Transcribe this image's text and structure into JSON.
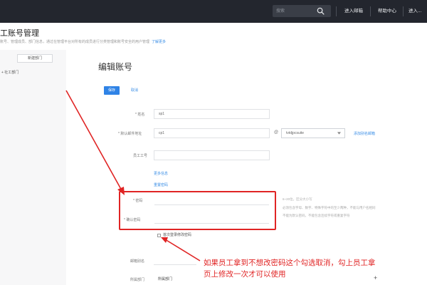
{
  "topbar": {
    "search_placeholder": "搜索",
    "nav": [
      "进入邮箱",
      "帮助中心",
      "进入..."
    ]
  },
  "page": {
    "title": "工账号管理",
    "desc": "账号、管理成员、部门信息，通过在管理平台对所有的成员进行分类管理和账号安全的用户管理",
    "learn_more": "了解更多"
  },
  "sidebar": {
    "new_dept": "新建部门",
    "tree_item": "+ 社工部门"
  },
  "form": {
    "title": "编辑账号",
    "save": "保存",
    "cancel": "取消",
    "name_label": "* 姓名",
    "name_value": "sp1",
    "account_label": "* 默认邮件地址",
    "account_value": "cp1",
    "at": "@",
    "domain_value": "tvtdjpcsuite",
    "bind_link": "添加别名邮箱",
    "employee_id_label": "员工工号",
    "more_link": "更多信息",
    "reset_link": "重置密码",
    "password_label": "* 密码",
    "confirm_label": "* 确认密码",
    "pwd_hint_1": "6~20位，区分大小写",
    "pwd_hint_2": "必须包含字母、数字、特殊字符中的至少两种，不能与用户名相同",
    "pwd_hint_3": "不能为默认密码，不能包含连续字符或重复字符",
    "force_change_label": "首次登录修改密码",
    "nickname_label": "邮箱别名",
    "dept_label": "所属部门",
    "dept_value": "所属部门",
    "add_symbol": "+"
  },
  "annotation": {
    "line1": "如果员工拿到不想改密码这个勾选取消，勾上员工拿",
    "line2": "页上修改一次才可以使用"
  },
  "colors": {
    "topbar_bg": "#23262e",
    "primary": "#2f83e6",
    "annotation_red": "#e02424"
  }
}
